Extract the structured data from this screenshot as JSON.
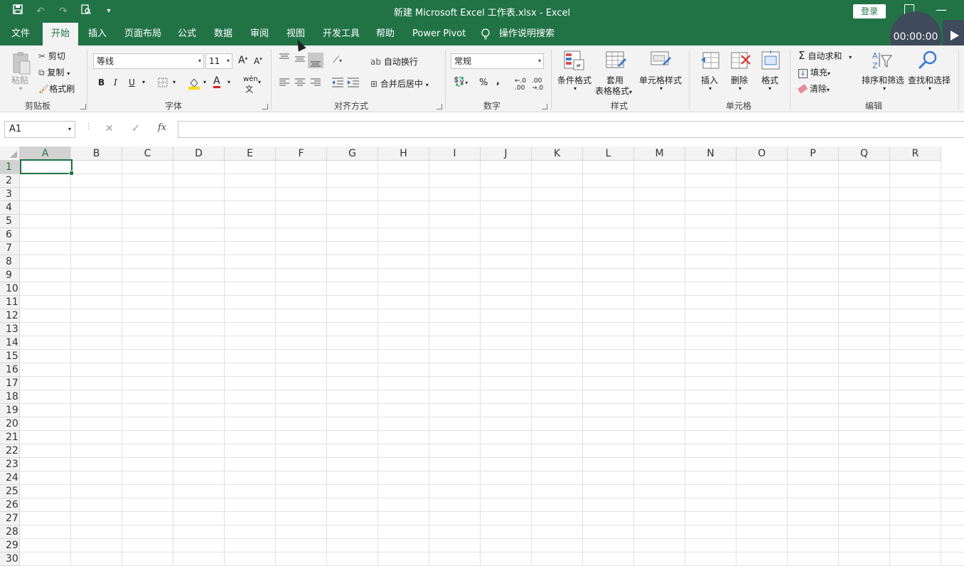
{
  "window": {
    "title": "新建 Microsoft Excel 工作表.xlsx  -  Excel",
    "login_label": "登录"
  },
  "quick_access": [
    "save-icon",
    "undo-icon",
    "redo-icon",
    "print-preview-icon",
    "customize-icon"
  ],
  "tabs": [
    {
      "label": "文件"
    },
    {
      "label": "开始"
    },
    {
      "label": "插入"
    },
    {
      "label": "页面布局"
    },
    {
      "label": "公式"
    },
    {
      "label": "数据"
    },
    {
      "label": "审阅"
    },
    {
      "label": "视图"
    },
    {
      "label": "开发工具"
    },
    {
      "label": "帮助"
    },
    {
      "label": "Power Pivot"
    }
  ],
  "active_tab": "开始",
  "tell_me": "操作说明搜索",
  "timer": "00:00:00",
  "ribbon": {
    "clipboard": {
      "label": "剪贴板",
      "paste": "粘贴",
      "cut": "剪切",
      "copy": "复制",
      "format_painter": "格式刷"
    },
    "font": {
      "label": "字体",
      "font_name": "等线",
      "font_size": "11",
      "bold": "B",
      "italic": "I",
      "underline": "U",
      "grow": "A",
      "shrink": "A",
      "font_color": "A",
      "phonetic": "wén"
    },
    "alignment": {
      "label": "对齐方式",
      "wrap_text": "自动换行",
      "merge_center": "合并后居中"
    },
    "number": {
      "label": "数字",
      "format": "常规",
      "percent": "%",
      "comma": ",",
      "inc_decimal": "←.0 .00",
      "dec_decimal": ".00 →.0"
    },
    "styles": {
      "label": "样式",
      "conditional": "条件格式",
      "table_format_1": "套用",
      "table_format_2": "表格格式",
      "cell_styles": "单元格样式"
    },
    "cells": {
      "label": "单元格",
      "insert": "插入",
      "delete": "删除",
      "format": "格式"
    },
    "editing": {
      "label": "编辑",
      "autosum": "自动求和",
      "fill": "填充",
      "clear": "清除",
      "sort_filter": "排序和筛选",
      "find_select": "查找和选择"
    }
  },
  "formula_bar": {
    "name_box": "A1",
    "cancel": "✕",
    "enter": "✓",
    "fx": "fx",
    "value": ""
  },
  "sheet": {
    "columns": [
      "A",
      "B",
      "C",
      "D",
      "E",
      "F",
      "G",
      "H",
      "I",
      "J",
      "K",
      "L",
      "M",
      "N",
      "O",
      "P",
      "Q",
      "R"
    ],
    "rows": [
      "1",
      "2",
      "3",
      "4",
      "5",
      "6",
      "7",
      "8",
      "9",
      "10",
      "11",
      "12",
      "13",
      "14",
      "15",
      "16",
      "17",
      "18",
      "19",
      "20",
      "21",
      "22",
      "23",
      "24",
      "25",
      "26",
      "27",
      "28",
      "29",
      "30"
    ],
    "active_cell": "A1"
  },
  "colors": {
    "accent": "#217346",
    "ribbon_bg": "#f3f3f3",
    "timer_bg": "#3f4a5a"
  }
}
